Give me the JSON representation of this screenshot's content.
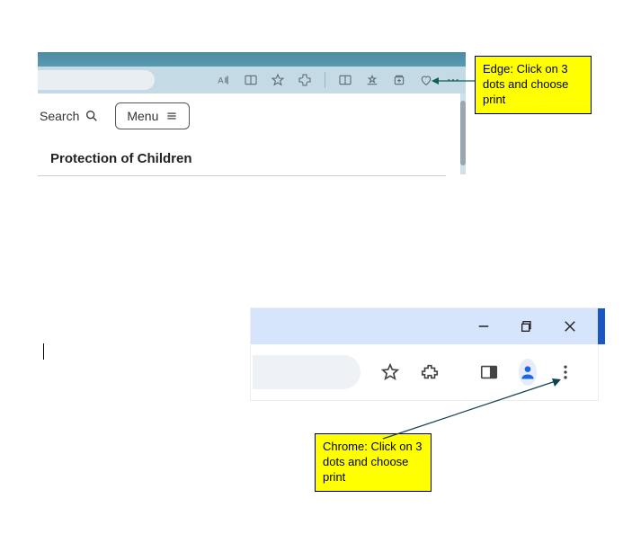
{
  "edge": {
    "callout": "Edge:  Click on 3 dots and choose print",
    "page": {
      "search_label": "Search",
      "menu_label": "Menu",
      "heading": "Protection of Children"
    },
    "toolbar_icons": [
      "read-aloud-icon",
      "immersive-reader-icon",
      "favorite-star-icon",
      "extensions-icon",
      "split-screen-icon",
      "favorites-list-icon",
      "collections-icon",
      "browser-essentials-icon",
      "more-menu-icon"
    ]
  },
  "chrome": {
    "callout": "Chrome:  Click on 3 dots and choose print",
    "window_controls": [
      "minimize-icon",
      "maximize-icon",
      "close-icon"
    ],
    "toolbar_icons": [
      "bookmark-star-icon",
      "extensions-puzzle-icon",
      "side-panel-icon",
      "profile-avatar-icon",
      "more-menu-icon"
    ]
  }
}
